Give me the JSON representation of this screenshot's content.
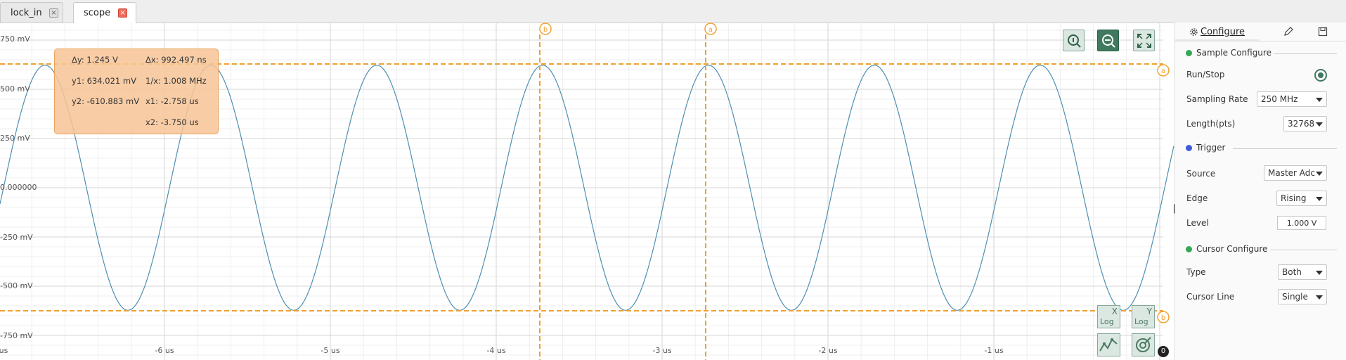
{
  "tabs": [
    {
      "label": "lock_in",
      "close": "×",
      "active": false
    },
    {
      "label": "scope",
      "close": "×",
      "active": true
    }
  ],
  "colors": {
    "accent_orange": "#f0a030",
    "trace": "#4f8fb0",
    "green_dot": "#34a853",
    "blue_dot": "#3d5bd9"
  },
  "plot": {
    "y_ticks": [
      "750 mV",
      "500 mV",
      "250 mV",
      "0.000000",
      "-250 mV",
      "-500 mV",
      "-750 mV"
    ],
    "x_ticks": [
      "us",
      "-6 us",
      "-5 us",
      "-4 us",
      "-3 us",
      "-2 us",
      "-1 us"
    ],
    "cursor_labels": {
      "vertical_b": "b",
      "vertical_a": "a",
      "horizontal_a": "a",
      "horizontal_b": "b"
    },
    "trace_amplitude_mv": 622.5,
    "trace_period_us": 1.0,
    "toolbar_icons": [
      "zoom-info-icon",
      "zoom-out-icon",
      "fullscreen-icon"
    ],
    "log_x": {
      "axis": "X",
      "label": "Log"
    },
    "log_y": {
      "axis": "Y",
      "label": "Log"
    },
    "bottom_icons": [
      "waveform-icon",
      "target-icon"
    ],
    "counter": "0"
  },
  "cursor_info": {
    "dy": "Δy: 1.245 V",
    "dx": "Δx: 992.497 ns",
    "y1": "y1: 634.021 mV",
    "inv_x": "1/x: 1.008 MHz",
    "y2": "y2: -610.883 mV",
    "x1": "x1: -2.758 us",
    "x2": "x2: -3.750 us"
  },
  "panel": {
    "tab_configure": "Configure",
    "sample": {
      "title": "Sample Configure",
      "run_stop_label": "Run/Stop",
      "sampling_rate_label": "Sampling Rate",
      "sampling_rate_value": "250 MHz",
      "length_label": "Length(pts)",
      "length_value": "32768"
    },
    "trigger": {
      "title": "Trigger",
      "source_label": "Source",
      "source_value": "Master Adc",
      "edge_label": "Edge",
      "edge_value": "Rising",
      "level_label": "Level",
      "level_value": "1.000 V"
    },
    "cursor": {
      "title": "Cursor Configure",
      "type_label": "Type",
      "type_value": "Both",
      "line_label": "Cursor Line",
      "line_value": "Single"
    }
  }
}
